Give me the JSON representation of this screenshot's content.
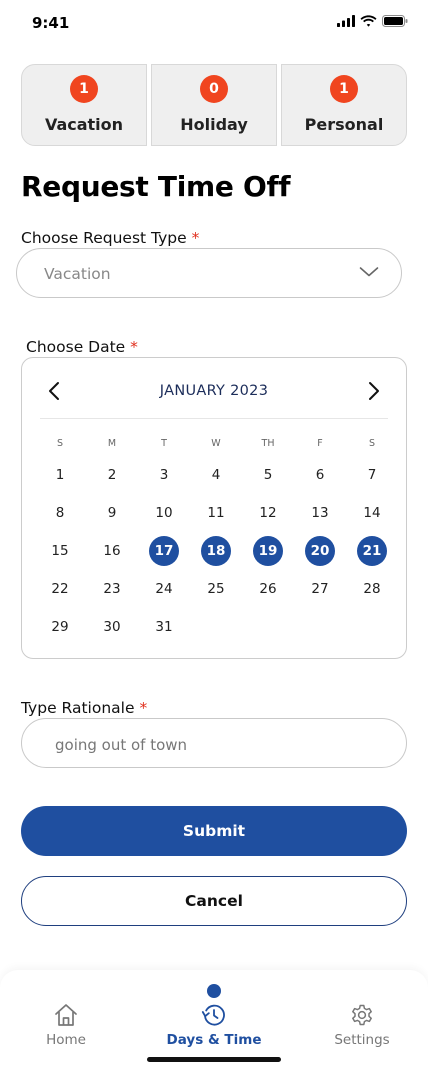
{
  "status_bar": {
    "time": "9:41"
  },
  "summary": [
    {
      "count": "1",
      "label": "Vacation"
    },
    {
      "count": "0",
      "label": "Holiday"
    },
    {
      "count": "1",
      "label": "Personal"
    }
  ],
  "page_title": "Request Time Off",
  "request_type": {
    "label": "Choose Request Type",
    "required": "*",
    "value": "Vacation"
  },
  "date": {
    "label": "Choose Date",
    "required": "*",
    "month": "JANUARY 2023",
    "weekdays": [
      "S",
      "M",
      "T",
      "W",
      "TH",
      "F",
      "S"
    ],
    "days": [
      "1",
      "2",
      "3",
      "4",
      "5",
      "6",
      "7",
      "8",
      "9",
      "10",
      "11",
      "12",
      "13",
      "14",
      "15",
      "16",
      "17",
      "18",
      "19",
      "20",
      "21",
      "22",
      "23",
      "24",
      "25",
      "26",
      "27",
      "28",
      "29",
      "30",
      "31"
    ],
    "selected": [
      "17",
      "18",
      "19",
      "20",
      "21"
    ]
  },
  "rationale": {
    "label": "Type Rationale",
    "required": "*",
    "value": "going out of town"
  },
  "buttons": {
    "submit": "Submit",
    "cancel": "Cancel"
  },
  "tabs": [
    {
      "label": "Home",
      "icon": "home-icon",
      "active": false
    },
    {
      "label": "Days & Time",
      "icon": "history-clock-icon",
      "active": true
    },
    {
      "label": "Settings",
      "icon": "gear-icon",
      "active": false
    }
  ],
  "colors": {
    "primary": "#1f4fa0",
    "badge": "#f0451f",
    "required": "#e0301e"
  }
}
